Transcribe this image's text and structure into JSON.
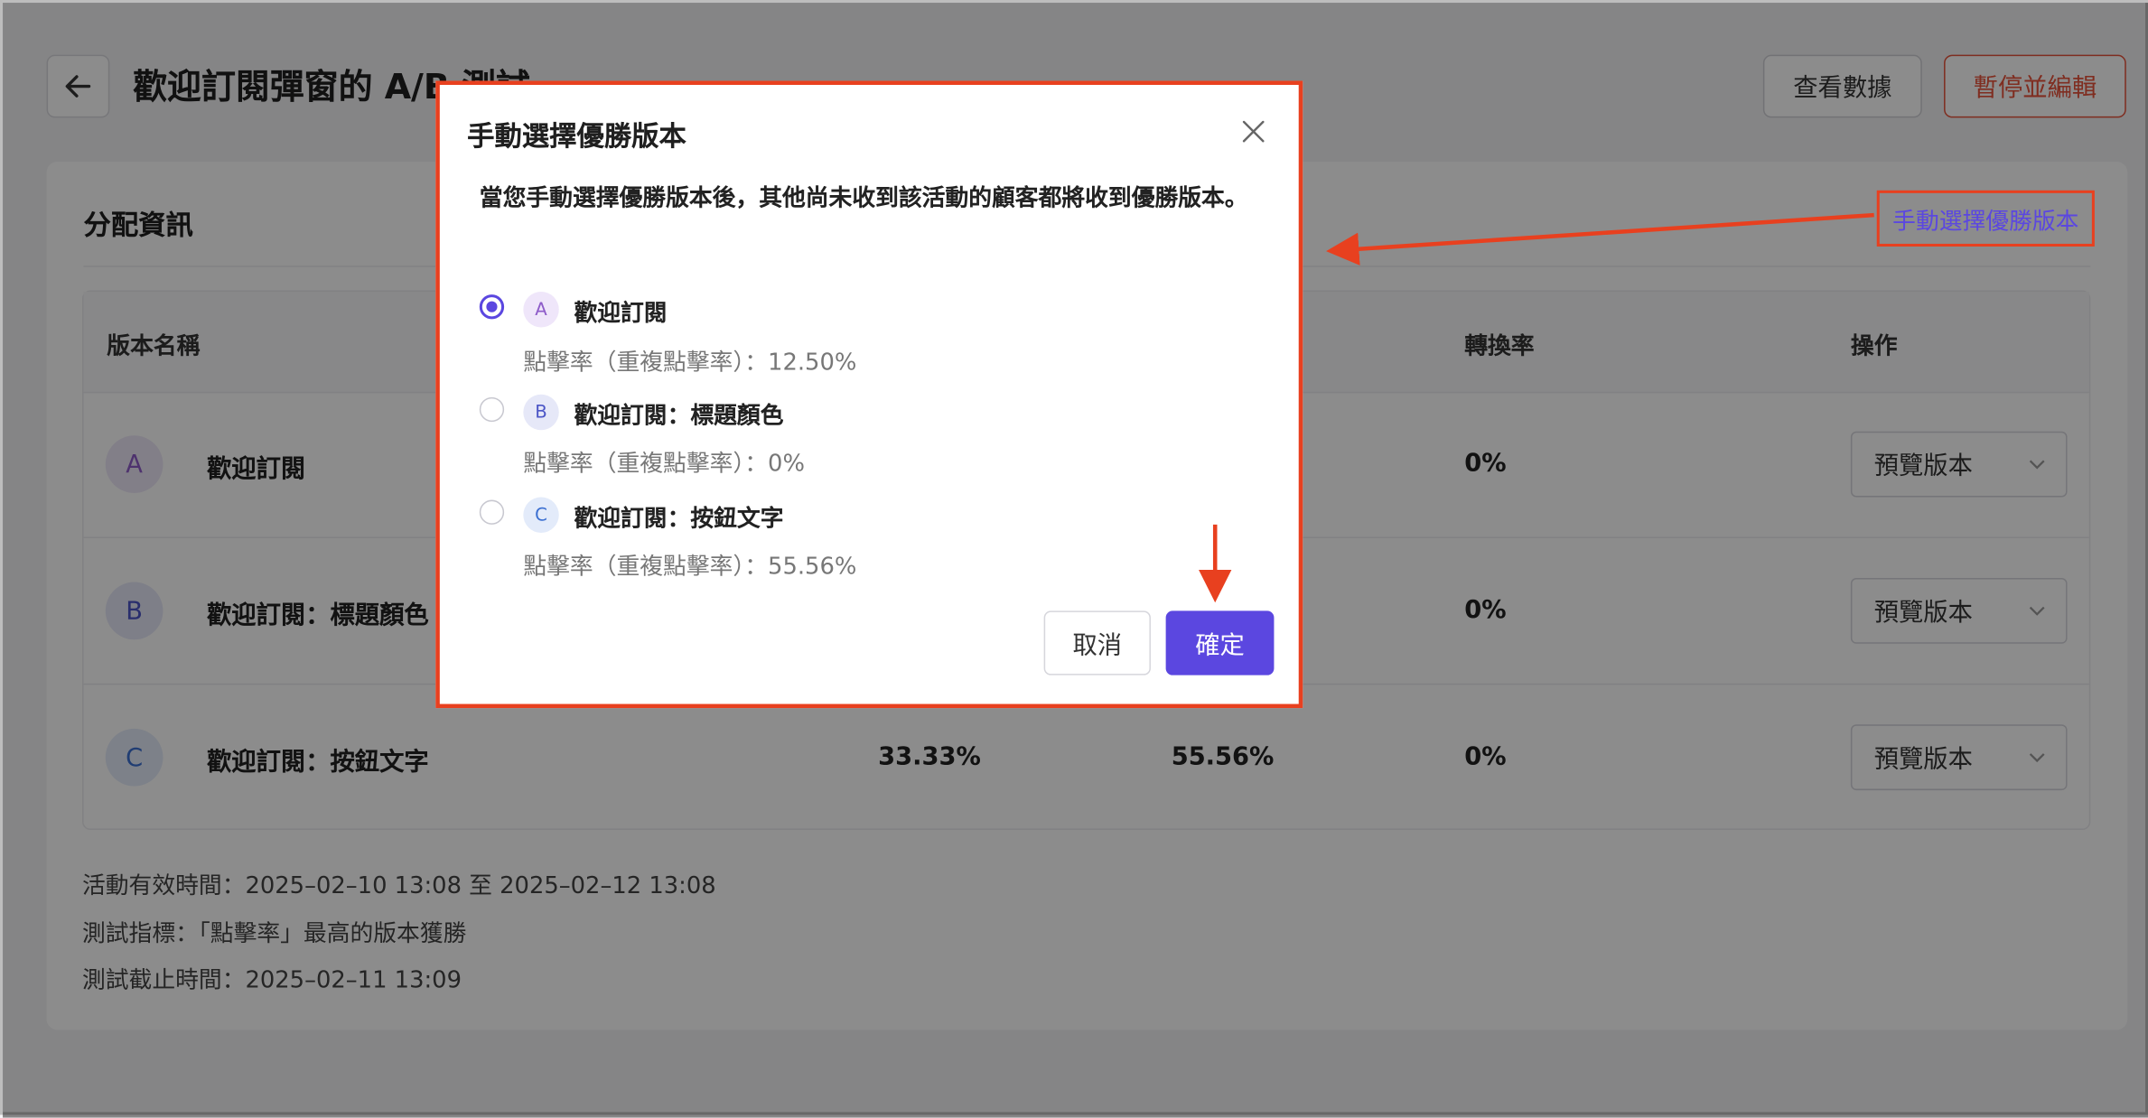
{
  "header": {
    "title": "歡迎訂閱彈窗的 A/B 測試",
    "view_data_label": "查看數據",
    "pause_edit_label": "暫停並編輯"
  },
  "card": {
    "section_title": "分配資訊",
    "winner_link_label": "手動選擇優勝版本"
  },
  "table": {
    "headers": {
      "name": "版本名稱",
      "conversion": "轉換率",
      "action": "操作"
    },
    "rows": [
      {
        "badge": "A",
        "name": "歡迎訂閱",
        "col1": "",
        "col2": "",
        "conversion": "0%",
        "action": "預覽版本"
      },
      {
        "badge": "B",
        "name": "歡迎訂閱：標題顏色",
        "col1": "",
        "col2": "",
        "conversion": "0%",
        "action": "預覽版本"
      },
      {
        "badge": "C",
        "name": "歡迎訂閱：按鈕文字",
        "col1": "33.33%",
        "col2": "55.56%",
        "conversion": "0%",
        "action": "預覽版本"
      }
    ]
  },
  "info": {
    "active_time": "活動有效時間：2025–02–10 13:08 至 2025–02–12 13:08",
    "metric": "測試指標：「點擊率」最高的版本獲勝",
    "deadline": "測試截止時間：2025–02–11 13:09"
  },
  "modal": {
    "title": "手動選擇優勝版本",
    "description": "當您手動選擇優勝版本後，其他尚未收到該活動的顧客都將收到優勝版本。",
    "options": [
      {
        "badge": "A",
        "name": "歡迎訂閱",
        "rate": "點擊率（重複點擊率）：12.50%",
        "selected": true
      },
      {
        "badge": "B",
        "name": "歡迎訂閱：標題顏色",
        "rate": "點擊率（重複點擊率）：0%",
        "selected": false
      },
      {
        "badge": "C",
        "name": "歡迎訂閱：按鈕文字",
        "rate": "點擊率（重複點擊率）：55.56%",
        "selected": false
      }
    ],
    "cancel_label": "取消",
    "confirm_label": "確定"
  },
  "colors": {
    "accent": "#5b47e0",
    "danger": "#e8533b",
    "annotation": "#e8401f"
  }
}
